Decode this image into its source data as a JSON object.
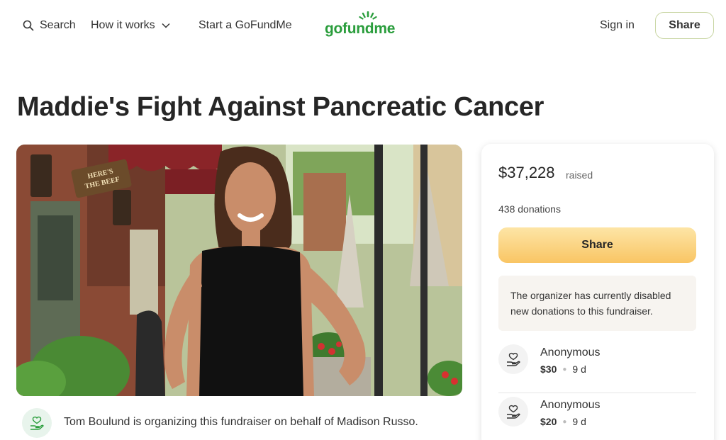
{
  "header": {
    "search_label": "Search",
    "how_label": "How it works",
    "start_label": "Start a GoFundMe",
    "logo_text": "gofundme",
    "signin_label": "Sign in",
    "share_label": "Share"
  },
  "campaign": {
    "title": "Maddie's Fight Against Pancreatic Cancer",
    "sign_text": "HERE'S THE BEEF",
    "organizer_text": "Tom Boulund is organizing this fundraiser on behalf of Madison Russo."
  },
  "donations": {
    "raised_amount": "$37,228",
    "raised_label": "raised",
    "count_text": "438 donations",
    "share_label": "Share",
    "notice_line1": "The organizer has currently disabled",
    "notice_line2": "new donations to this fundraiser.",
    "donors": [
      {
        "name": "Anonymous",
        "amount": "$30",
        "time": "9 d"
      },
      {
        "name": "Anonymous",
        "amount": "$20",
        "time": "9 d"
      }
    ]
  },
  "colors": {
    "brand_green": "#2a9d3c",
    "share_button_top": "#fde5a6",
    "share_button_bottom": "#f9c564",
    "text_dark": "#262626"
  },
  "icons": [
    "search-icon",
    "chevron-down-icon",
    "gofundme-logo-icon",
    "heart-hand-icon"
  ]
}
